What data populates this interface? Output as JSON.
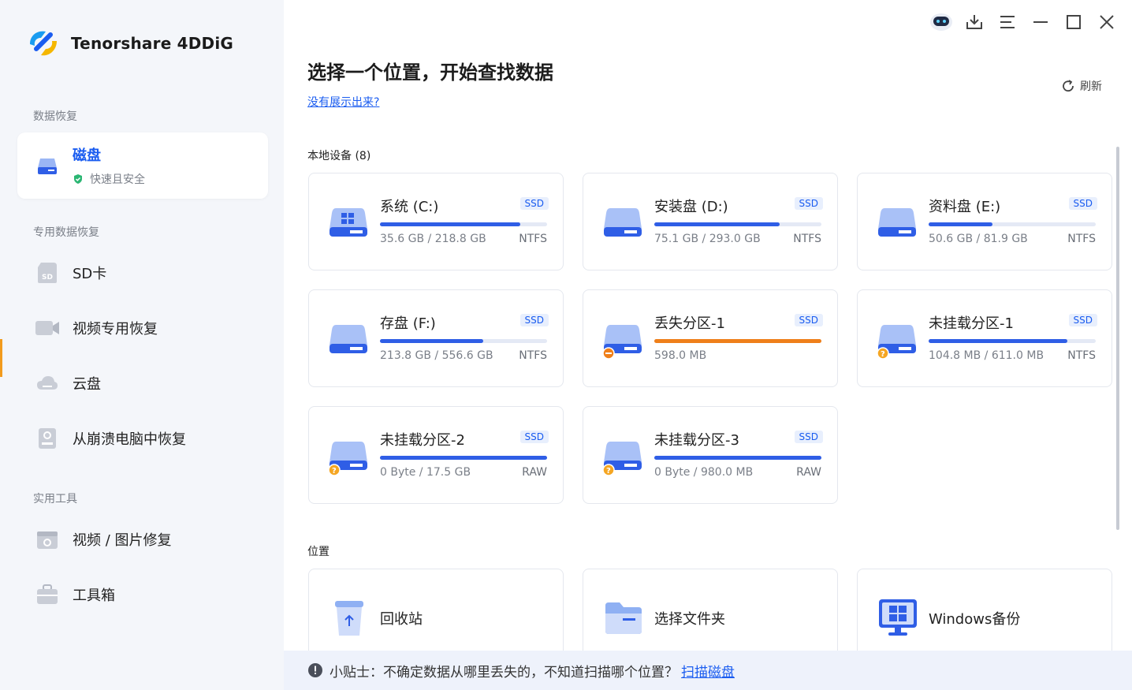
{
  "app": {
    "name": "Tenorshare 4DDiG"
  },
  "colors": {
    "accent": "#1a5cf0",
    "bar": "#2f5ee6",
    "bar_warn": "#ef7f1a",
    "sidebar_bg": "#f4f6fa"
  },
  "sidebar": {
    "sections": [
      {
        "label": "数据恢复",
        "items": [
          {
            "label": "磁盘",
            "sub": "快速且安全",
            "icon": "disk-icon",
            "active": true
          }
        ]
      },
      {
        "label": "专用数据恢复",
        "items": [
          {
            "label": "SD卡",
            "icon": "sd-card-icon"
          },
          {
            "label": "视频专用恢复",
            "icon": "video-camera-icon"
          },
          {
            "label": "云盘",
            "icon": "cloud-icon"
          },
          {
            "label": "从崩溃电脑中恢复",
            "icon": "crashed-pc-icon"
          }
        ]
      },
      {
        "label": "实用工具",
        "items": [
          {
            "label": "视频 / 图片修复",
            "icon": "media-repair-icon"
          },
          {
            "label": "工具箱",
            "icon": "toolbox-icon"
          }
        ]
      }
    ]
  },
  "toolbar": {
    "buttons": [
      "assistant-icon",
      "download-icon",
      "menu-icon",
      "minimize-icon",
      "maximize-icon",
      "close-icon"
    ]
  },
  "main": {
    "title": "选择一个位置，开始查找数据",
    "help_link": "没有展示出来?",
    "refresh_label": "刷新",
    "local_devices": {
      "label": "本地设备 (8)",
      "drives": [
        {
          "name": "系统 (C:)",
          "badge": "SSD",
          "size": "35.6 GB / 218.8 GB",
          "fs": "NTFS",
          "used": 0.84,
          "status": "windows"
        },
        {
          "name": "安装盘 (D:)",
          "badge": "SSD",
          "size": "75.1 GB / 293.0 GB",
          "fs": "NTFS",
          "used": 0.75,
          "status": "normal"
        },
        {
          "name": "资料盘 (E:)",
          "badge": "SSD",
          "size": "50.6 GB / 81.9 GB",
          "fs": "NTFS",
          "used": 0.38,
          "status": "normal"
        },
        {
          "name": "存盘 (F:)",
          "badge": "SSD",
          "size": "213.8 GB / 556.6 GB",
          "fs": "NTFS",
          "used": 0.62,
          "status": "normal"
        },
        {
          "name": "丢失分区-1",
          "badge": "SSD",
          "size": "598.0 MB",
          "fs": "",
          "used": 1.0,
          "status": "lost"
        },
        {
          "name": "未挂载分区-1",
          "badge": "SSD",
          "size": "104.8 MB / 611.0 MB",
          "fs": "NTFS",
          "used": 0.83,
          "status": "unmounted"
        },
        {
          "name": "未挂载分区-2",
          "badge": "SSD",
          "size": "0 Byte / 17.5 GB",
          "fs": "RAW",
          "used": 1.0,
          "status": "unmounted"
        },
        {
          "name": "未挂载分区-3",
          "badge": "SSD",
          "size": "0 Byte / 980.0 MB",
          "fs": "RAW",
          "used": 1.0,
          "status": "unmounted"
        }
      ]
    },
    "locations": {
      "label": "位置",
      "items": [
        {
          "label": "回收站",
          "icon": "recycle-bin-icon"
        },
        {
          "label": "选择文件夹",
          "icon": "folder-icon"
        },
        {
          "label": "Windows备份",
          "icon": "windows-backup-icon"
        }
      ]
    },
    "tip": {
      "text": "小贴士：不确定数据从哪里丢失的，不知道扫描哪个位置？",
      "link": "扫描磁盘"
    }
  }
}
